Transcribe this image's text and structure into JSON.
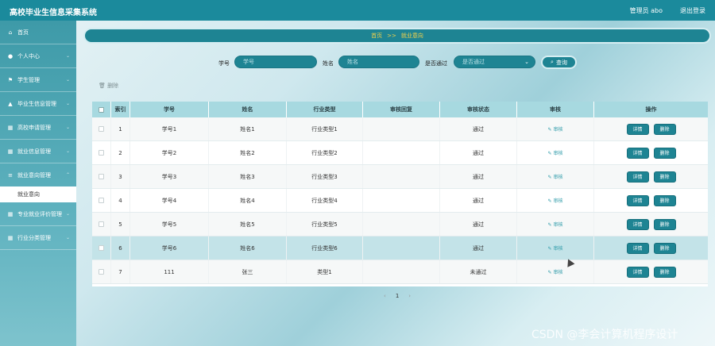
{
  "app": {
    "title": "高校毕业生信息采集系统",
    "user_label": "管理员 abo",
    "logout_label": "退出登录"
  },
  "sidebar": {
    "items": [
      {
        "label": "首页",
        "icon": "home-icon",
        "glyph": "⌂"
      },
      {
        "label": "个人中心",
        "icon": "user-icon",
        "glyph": "●"
      },
      {
        "label": "学生管理",
        "icon": "flag-icon",
        "glyph": "⚑"
      },
      {
        "label": "毕业生信息管理",
        "icon": "chart-icon",
        "glyph": "▲"
      },
      {
        "label": "高校申请管理",
        "icon": "grid-icon",
        "glyph": "▦"
      },
      {
        "label": "就业信息管理",
        "icon": "grid-icon",
        "glyph": "▦"
      },
      {
        "label": "就业意向管理",
        "icon": "list-icon",
        "glyph": "≡"
      },
      {
        "label": "专业就业评价管理",
        "icon": "grid-icon",
        "glyph": "▦"
      },
      {
        "label": "行业分类管理",
        "icon": "grid-icon",
        "glyph": "▦"
      }
    ],
    "active_sub": "就业意向"
  },
  "breadcrumb": {
    "home": "首页",
    "separator": ">>",
    "current": "就业意向"
  },
  "search": {
    "student_no_label": "学号",
    "student_no_placeholder": "学号",
    "name_label": "姓名",
    "name_placeholder": "姓名",
    "pass_label": "是否通过",
    "pass_placeholder": "是否通过",
    "search_button": "查询"
  },
  "toolbar": {
    "delete_label": "删除"
  },
  "table": {
    "headers": [
      "",
      "索引",
      "学号",
      "姓名",
      "行业类型",
      "审核回复",
      "审核状态",
      "审核",
      "操作"
    ],
    "rows": [
      {
        "index": "1",
        "student_no": "学号1",
        "name": "姓名1",
        "industry": "行业类型1",
        "reply": "",
        "status": "通过",
        "review": "审核",
        "detail": "详情",
        "delete": "删除"
      },
      {
        "index": "2",
        "student_no": "学号2",
        "name": "姓名2",
        "industry": "行业类型2",
        "reply": "",
        "status": "通过",
        "review": "审核",
        "detail": "详情",
        "delete": "删除"
      },
      {
        "index": "3",
        "student_no": "学号3",
        "name": "姓名3",
        "industry": "行业类型3",
        "reply": "",
        "status": "通过",
        "review": "审核",
        "detail": "详情",
        "delete": "删除"
      },
      {
        "index": "4",
        "student_no": "学号4",
        "name": "姓名4",
        "industry": "行业类型4",
        "reply": "",
        "status": "通过",
        "review": "审核",
        "detail": "详情",
        "delete": "删除"
      },
      {
        "index": "5",
        "student_no": "学号5",
        "name": "姓名5",
        "industry": "行业类型5",
        "reply": "",
        "status": "通过",
        "review": "审核",
        "detail": "详情",
        "delete": "删除"
      },
      {
        "index": "6",
        "student_no": "学号6",
        "name": "姓名6",
        "industry": "行业类型6",
        "reply": "",
        "status": "通过",
        "review": "审核",
        "detail": "详情",
        "delete": "删除"
      },
      {
        "index": "7",
        "student_no": "111",
        "name": "张三",
        "industry": "类型1",
        "reply": "",
        "status": "未通过",
        "review": "审核",
        "detail": "详情",
        "delete": "删除"
      }
    ]
  },
  "pagination": {
    "prev": "‹",
    "page": "1",
    "next": "›"
  },
  "watermark": "CSDN @李会计算机程序设计",
  "colors": {
    "primary": "#1e8493",
    "header_bg": "#a7d9e0",
    "highlight_row": "#c3e3e8",
    "breadcrumb_text": "#f2d24a"
  }
}
